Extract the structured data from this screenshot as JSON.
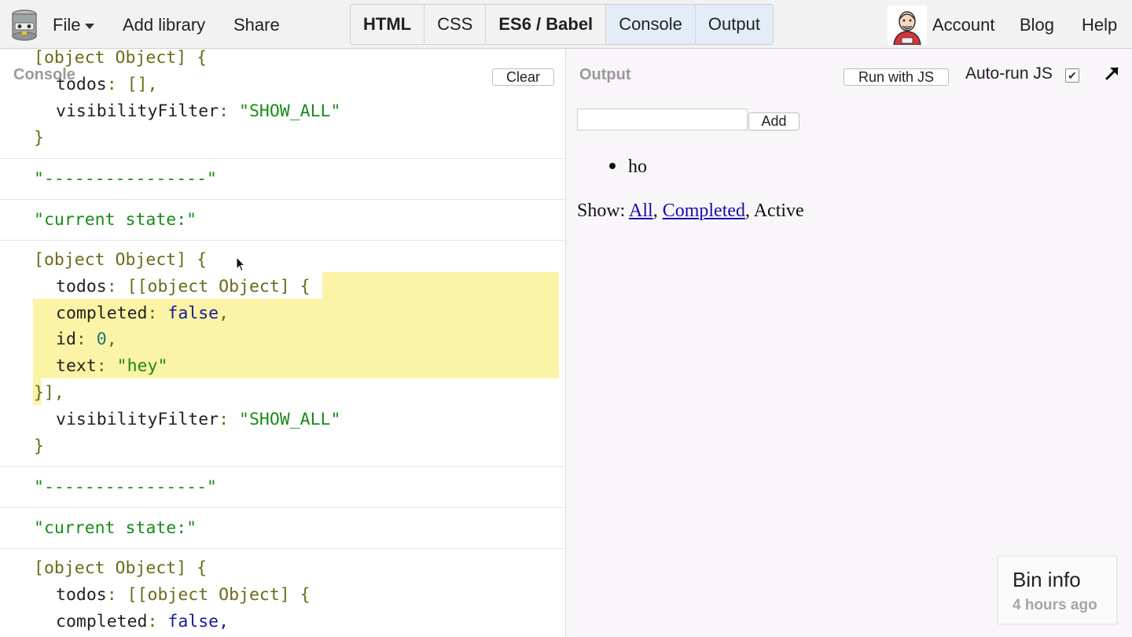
{
  "topbar": {
    "file_label": "File",
    "add_library_label": "Add library",
    "share_label": "Share",
    "panels": [
      {
        "label": "HTML",
        "bold": true,
        "active": false
      },
      {
        "label": "CSS",
        "bold": false,
        "active": false
      },
      {
        "label": "ES6 / Babel",
        "bold": true,
        "active": false
      },
      {
        "label": "Console",
        "bold": false,
        "active": true
      },
      {
        "label": "Output",
        "bold": false,
        "active": true
      }
    ],
    "account_label": "Account",
    "blog_label": "Blog",
    "help_label": "Help"
  },
  "console": {
    "title": "Console",
    "clear_label": "Clear",
    "entries": {
      "e1": {
        "open": "[object Object] {",
        "todos_key": "todos",
        "todos_val": "[]",
        "filter_key": "visibilityFilter",
        "filter_val": "\"SHOW_ALL\"",
        "close": "}"
      },
      "sep1": "\"----------------\"",
      "state1": "\"current state:\"",
      "e2": {
        "open": "[object Object] {",
        "todos_key": "todos",
        "todos_open": "[[object Object] {",
        "completed_key": "completed",
        "completed_val": "false",
        "id_key": "id",
        "id_val": "0",
        "text_key": "text",
        "text_val": "\"hey\"",
        "todos_close": "}],",
        "filter_key": "visibilityFilter",
        "filter_val": "\"SHOW_ALL\"",
        "close": "}"
      },
      "sep2": "\"----------------\"",
      "state2": "\"current state:\"",
      "e3": {
        "open": "[object Object] {",
        "todos_key": "todos",
        "todos_open": "[[object Object] {",
        "completed_key": "completed",
        "completed_val": "false,"
      }
    }
  },
  "output": {
    "title": "Output",
    "run_label": "Run with JS",
    "autorun_label": "Auto-run JS",
    "autorun_checked": "✔",
    "input_value": "",
    "add_label": "Add",
    "todos": [
      "ho"
    ],
    "filters": {
      "prefix": "Show: ",
      "all": "All",
      "sep": ", ",
      "completed": "Completed",
      "active": "Active"
    }
  },
  "bin_info": {
    "title": "Bin info",
    "time": "4 hours ago"
  }
}
